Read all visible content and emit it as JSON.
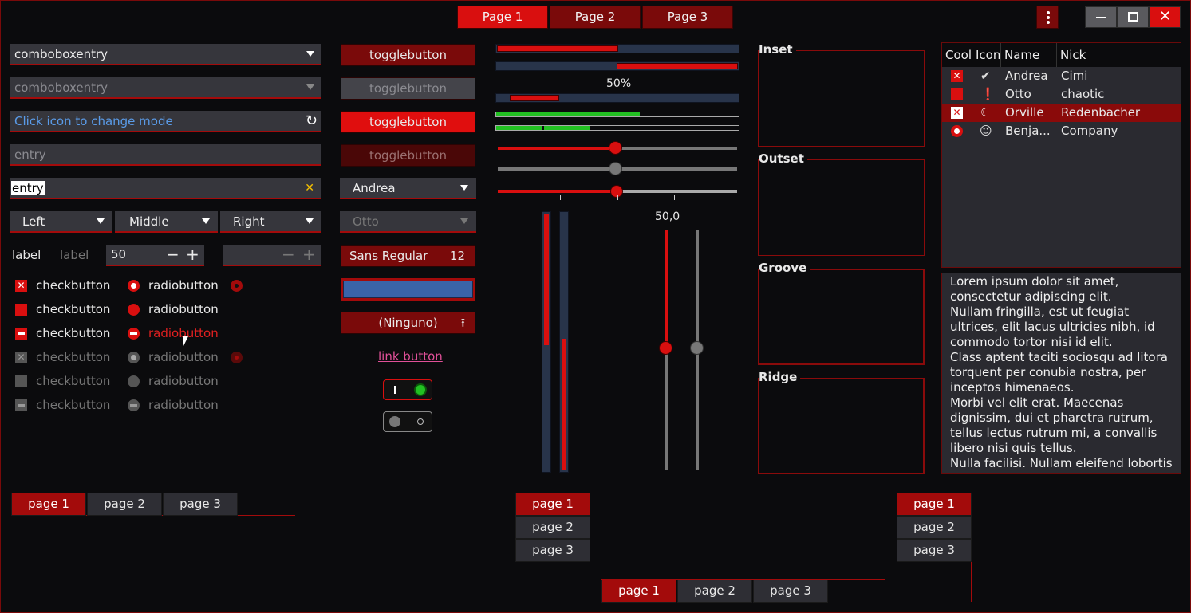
{
  "header": {
    "tabs": [
      "Page 1",
      "Page 2",
      "Page 3"
    ],
    "menu_icon": "vertical-dots-icon",
    "window_buttons": [
      "minimize-icon",
      "maximize-icon",
      "close-icon"
    ]
  },
  "col1": {
    "combo1": "comboboxentry",
    "combo2": "comboboxentry",
    "entry_icon_mode": "Click icon to change mode",
    "entry_placeholder": "entry",
    "entry_value": "entry",
    "combos": [
      "Left",
      "Middle",
      "Right"
    ],
    "label1": "label",
    "label2": "label",
    "spin_value": "50",
    "checks": [
      "checkbutton",
      "checkbutton",
      "checkbutton",
      "checkbutton",
      "checkbutton",
      "checkbutton"
    ],
    "radios": [
      "radiobutton",
      "radiobutton",
      "radiobutton",
      "radiobutton",
      "radiobutton",
      "radiobutton"
    ]
  },
  "col2": {
    "toggles": [
      "togglebutton",
      "togglebutton",
      "togglebutton",
      "togglebutton"
    ],
    "combo_andrea": "Andrea",
    "combo_otto": "Otto",
    "font_name": "Sans Regular",
    "font_size": "12",
    "file_button": "(Ninguno)",
    "link": "link button"
  },
  "scales": {
    "progress_label": "50%",
    "scale_value": "50,0",
    "progress": [
      0.5,
      0.5,
      0.5
    ],
    "level_bars": [
      0.6,
      0.4
    ]
  },
  "frames": [
    "Inset",
    "Outset",
    "Groove",
    "Ridge"
  ],
  "tree": {
    "columns": [
      "Cool",
      "Icon",
      "Name",
      "Nick"
    ],
    "rows": [
      {
        "name": "Andrea",
        "nick": "Cimi",
        "icon": "check-circle-icon"
      },
      {
        "name": "Otto",
        "nick": "chaotic",
        "icon": "warning-circle-icon"
      },
      {
        "name": "Orville",
        "nick": "Redenbacher",
        "icon": "moon-icon"
      },
      {
        "name": "Benja...",
        "nick": "Company",
        "icon": "face-icon"
      }
    ]
  },
  "textview": "Lorem ipsum dolor sit amet, consectetur adipiscing elit.\nNullam fringilla, est ut feugiat ultrices, elit lacus ultricies nibh, id commodo tortor nisi id elit.\nClass aptent taciti sociosqu ad litora torquent per conubia nostra, per inceptos himenaeos.\nMorbi vel elit erat. Maecenas dignissim, dui et pharetra rutrum, tellus lectus rutrum mi, a convallis libero nisi quis tellus.\nNulla facilisi. Nullam eleifend lobortis",
  "notebooks": {
    "tabs": [
      "page 1",
      "page 2",
      "page 3"
    ]
  },
  "colors": {
    "accent": "#d90f0f",
    "accent_dark": "#7a0a0a",
    "green": "#22c022"
  }
}
